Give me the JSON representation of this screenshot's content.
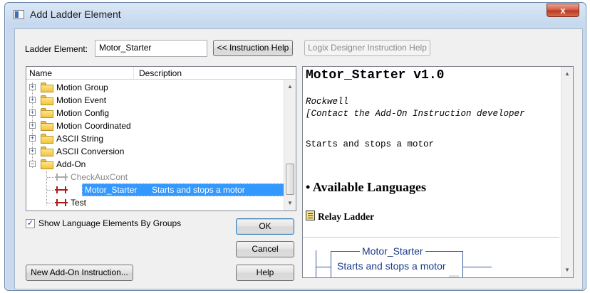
{
  "window": {
    "title": "Add Ladder Element",
    "close_glyph": "x"
  },
  "form": {
    "ladder_element_label": "Ladder Element:",
    "ladder_element_value": "Motor_Starter",
    "instruction_help_button": "<< Instruction Help",
    "logix_help_button": "Logix Designer Instruction Help"
  },
  "tree": {
    "columns": {
      "name": "Name",
      "description": "Description"
    },
    "items": [
      {
        "label": "Motion Group",
        "description": ""
      },
      {
        "label": "Motion Event",
        "description": ""
      },
      {
        "label": "Motion Config",
        "description": ""
      },
      {
        "label": "Motion Coordinated",
        "description": ""
      },
      {
        "label": "ASCII String",
        "description": ""
      },
      {
        "label": "ASCII Conversion",
        "description": ""
      },
      {
        "label": "Add-On",
        "description": ""
      },
      {
        "label": "CheckAuxCont",
        "description": ""
      },
      {
        "label": "Motor_Starter",
        "description": "Starts and stops a motor"
      },
      {
        "label": "Test",
        "description": ""
      }
    ]
  },
  "options": {
    "show_groups_label": "Show Language Elements By Groups",
    "show_groups_checked": true
  },
  "buttons": {
    "ok": "OK",
    "cancel": "Cancel",
    "help": "Help",
    "new_aoi": "New Add-On Instruction..."
  },
  "help": {
    "heading": "Motor_Starter v1.0",
    "vendor": "Rockwell",
    "contact": "[Contact the Add-On Instruction developer",
    "description": "Starts and stops a motor",
    "languages_heading": "• Available Languages",
    "relay_ladder": "Relay Ladder",
    "diagram_title": "Motor_Starter",
    "diagram_desc": "Starts and stops a motor"
  },
  "colors": {
    "selection": "#3399ff",
    "ladder_rung": "#b01818",
    "folder": "#f2c53c"
  }
}
